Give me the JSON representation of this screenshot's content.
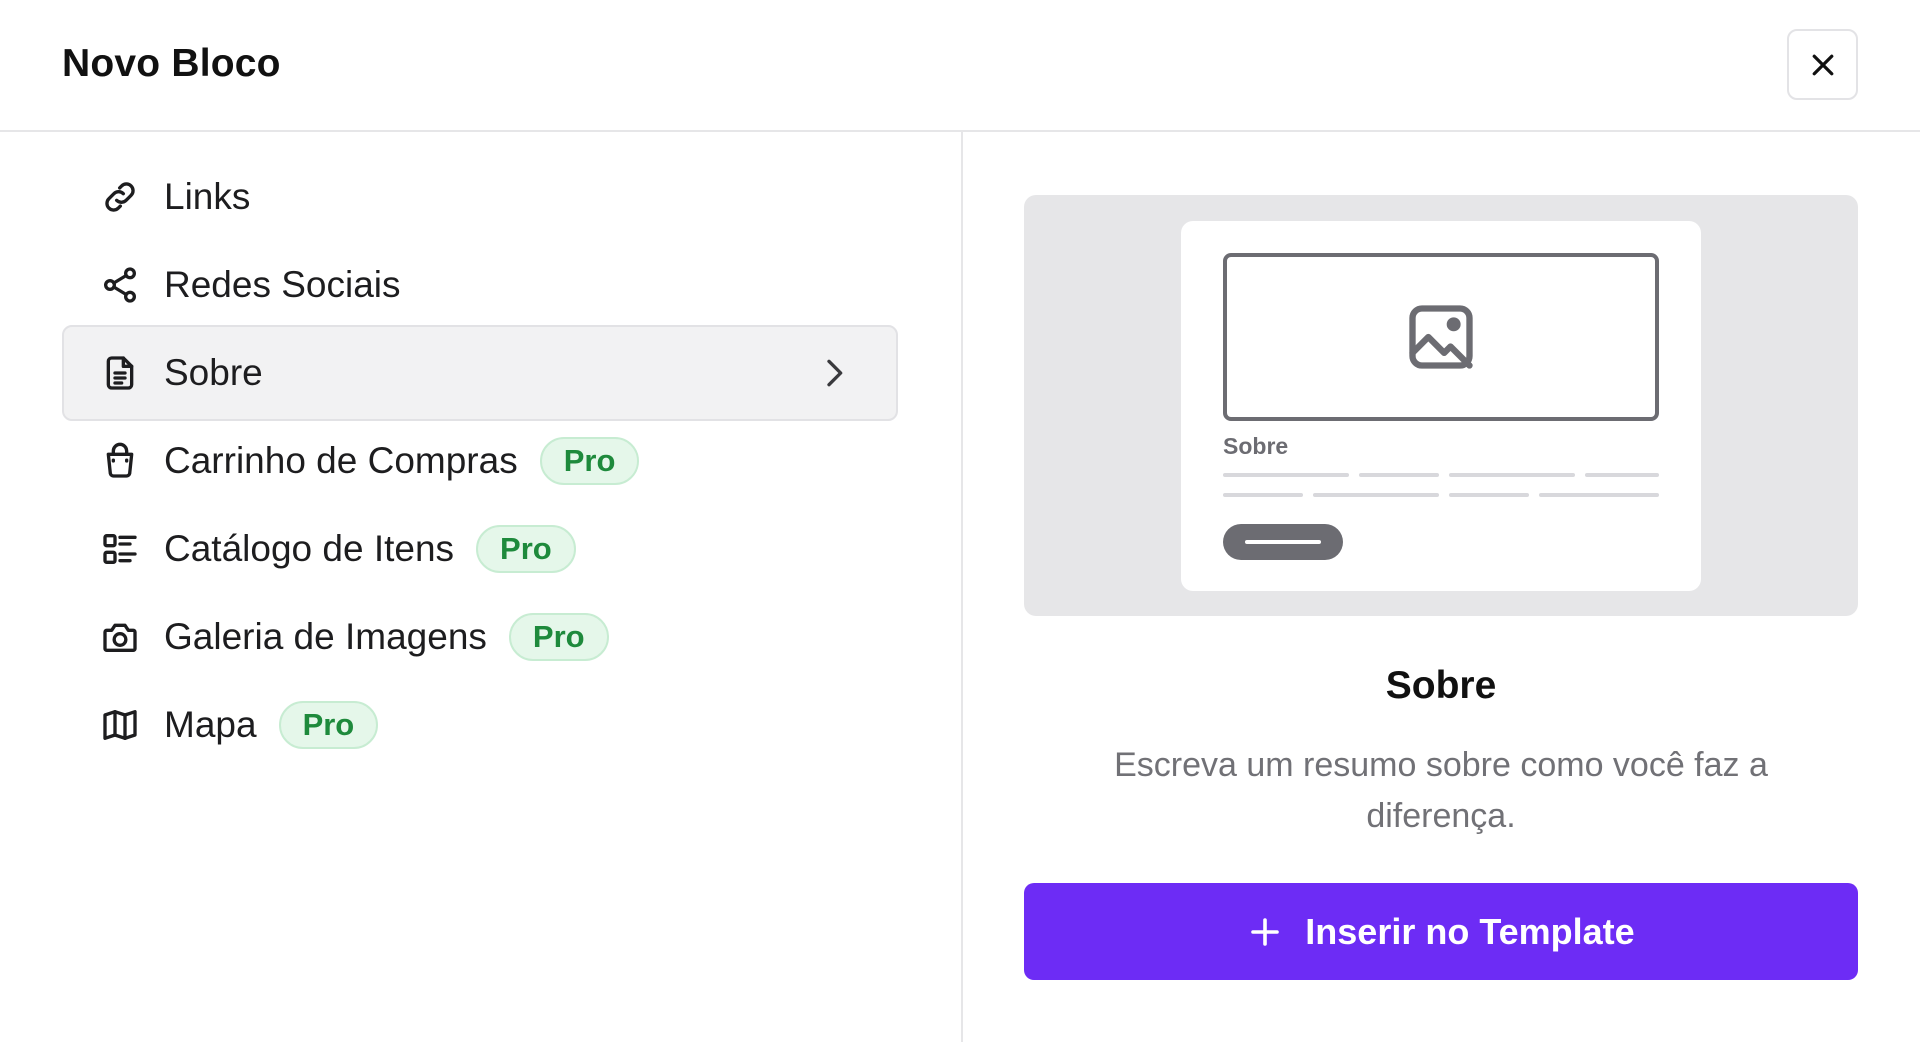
{
  "modal": {
    "title": "Novo Bloco"
  },
  "menu": {
    "items": [
      {
        "label": "Links",
        "icon": "link-icon",
        "badge": ""
      },
      {
        "label": "Redes Sociais",
        "icon": "share-icon",
        "badge": ""
      },
      {
        "label": "Sobre",
        "icon": "document-icon",
        "badge": "",
        "selected": true
      },
      {
        "label": "Carrinho de Compras",
        "icon": "shopping-bag-icon",
        "badge": "Pro"
      },
      {
        "label": "Catálogo de Itens",
        "icon": "list-icon",
        "badge": "Pro"
      },
      {
        "label": "Galeria de Imagens",
        "icon": "camera-icon",
        "badge": "Pro"
      },
      {
        "label": "Mapa",
        "icon": "map-icon",
        "badge": "Pro"
      }
    ]
  },
  "preview": {
    "card_title": "Sobre",
    "image_icon": "image-icon"
  },
  "detail": {
    "title": "Sobre",
    "description": "Escreva um resumo sobre como você faz a diferença.",
    "insert_label": "Inserir no Template"
  },
  "colors": {
    "accent": "#6d2cf5",
    "pro_badge_bg": "#e5f7ea",
    "pro_badge_text": "#1e8a3c"
  }
}
